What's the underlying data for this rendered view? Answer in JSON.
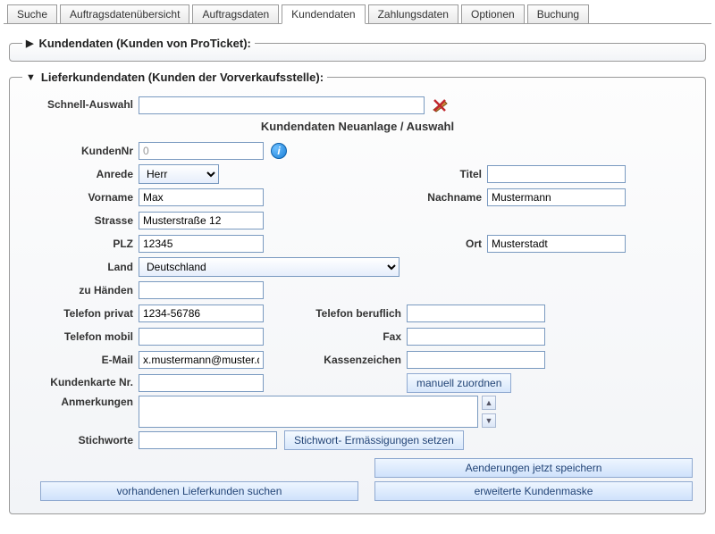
{
  "tabs": {
    "items": [
      {
        "label": "Suche"
      },
      {
        "label": "Auftragsdatenübersicht"
      },
      {
        "label": "Auftragsdaten"
      },
      {
        "label": "Kundendaten"
      },
      {
        "label": "Zahlungsdaten"
      },
      {
        "label": "Optionen"
      },
      {
        "label": "Buchung"
      }
    ],
    "active_index": 3
  },
  "section_top": {
    "title": "Kundendaten (Kunden von ProTicket):"
  },
  "section_main": {
    "title": "Lieferkundendaten (Kunden der Vorverkaufsstelle):",
    "heading": "Kundendaten Neuanlage / Auswahl",
    "labels": {
      "schnellauswahl": "Schnell-Auswahl",
      "kundennr": "KundenNr",
      "anrede": "Anrede",
      "titel": "Titel",
      "vorname": "Vorname",
      "nachname": "Nachname",
      "strasse": "Strasse",
      "plz": "PLZ",
      "ort": "Ort",
      "land": "Land",
      "zu_haenden": "zu Händen",
      "tel_privat": "Telefon privat",
      "tel_beruf": "Telefon beruflich",
      "tel_mobil": "Telefon mobil",
      "fax": "Fax",
      "email": "E-Mail",
      "kassenzeichen": "Kassenzeichen",
      "kundenkarte": "Kundenkarte Nr.",
      "anmerkungen": "Anmerkungen",
      "stichworte": "Stichworte"
    },
    "values": {
      "schnellauswahl": "",
      "kundennr": "0",
      "anrede": "Herr",
      "titel": "",
      "vorname": "Max",
      "nachname": "Mustermann",
      "strasse": "Musterstraße 12",
      "plz": "12345",
      "ort": "Musterstadt",
      "land": "Deutschland",
      "zu_haenden": "",
      "tel_privat": "1234-56786",
      "tel_beruf": "",
      "tel_mobil": "",
      "fax": "",
      "email": "x.mustermann@muster.de",
      "kassenzeichen": "",
      "kundenkarte": "",
      "anmerkungen": "",
      "stichworte": ""
    },
    "buttons": {
      "manuell_zuordnen": "manuell zuordnen",
      "stichwort_erm": "Stichwort- Ermässigungen setzen",
      "aenderungen_speichern": "Aenderungen jetzt speichern",
      "vorhandenen_suchen": "vorhandenen Lieferkunden suchen",
      "erweiterte_maske": "erweiterte Kundenmaske"
    }
  }
}
